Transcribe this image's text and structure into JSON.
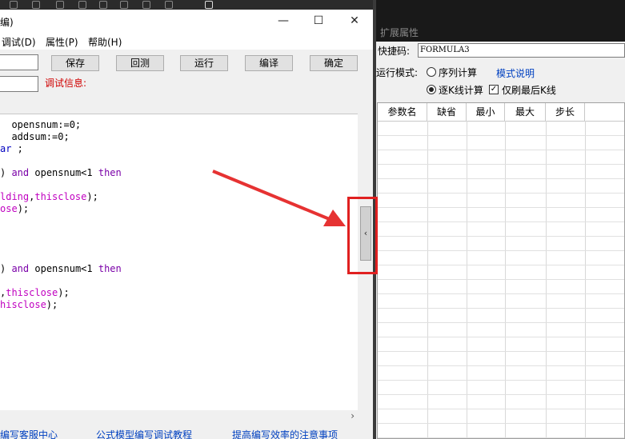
{
  "editor": {
    "title": "编)",
    "menu": [
      {
        "label": "调试(D)"
      },
      {
        "label": "属性(P)"
      },
      {
        "label": "帮助(H)"
      }
    ],
    "toolbar": {
      "save": "保存",
      "back": "回测",
      "run": "运行",
      "compile": "编译",
      "ok": "确定"
    },
    "debug_label": "调试信息:",
    "code_lines": [
      {
        "parts": [
          {
            "t": "  opensnum:=0;",
            "c": ""
          }
        ]
      },
      {
        "parts": [
          {
            "t": "  addsum:=0;",
            "c": ""
          }
        ]
      },
      {
        "parts": [
          {
            "t": "ar",
            "c": "bl"
          },
          {
            "t": " ;",
            "c": ""
          }
        ]
      },
      {
        "parts": [
          {
            "t": ") ",
            "c": ""
          },
          {
            "t": "and",
            "c": "kw"
          },
          {
            "t": " opensnum<1 ",
            "c": ""
          },
          {
            "t": "then",
            "c": "kw"
          }
        ]
      },
      {
        "parts": [
          {
            "t": "lding",
            "c": "vb"
          },
          {
            "t": ",",
            "c": ""
          },
          {
            "t": "thisclose",
            "c": "vb"
          },
          {
            "t": ");",
            "c": ""
          }
        ]
      },
      {
        "parts": [
          {
            "t": "ose",
            "c": "vb"
          },
          {
            "t": ");",
            "c": ""
          }
        ]
      },
      {
        "parts": [
          {
            "t": ") ",
            "c": ""
          },
          {
            "t": "and",
            "c": "kw"
          },
          {
            "t": " opensnum<1 ",
            "c": ""
          },
          {
            "t": "then",
            "c": "kw"
          }
        ]
      },
      {
        "parts": [
          {
            "t": ",",
            "c": ""
          },
          {
            "t": "thisclose",
            "c": "vb"
          },
          {
            "t": ");",
            "c": ""
          }
        ]
      },
      {
        "parts": [
          {
            "t": "hisclose",
            "c": "vb"
          },
          {
            "t": ");",
            "c": ""
          }
        ]
      }
    ],
    "bottom_links": [
      "编写客服中心",
      "公式模型编写调试教程",
      "提高编写效率的注意事项"
    ]
  },
  "panel": {
    "title": "扩展属性",
    "formula_label": "快捷码:",
    "formula_value": "FORMULA3",
    "mode_label": "运行模式:",
    "mode_option1": "序列计算",
    "mode_option2": "逐K线计算",
    "mode_link": "模式说明",
    "last_only": "仅刷最后K线",
    "grid_headers": [
      "参数名",
      "缺省",
      "最小",
      "最大",
      "步长"
    ]
  },
  "colors": {
    "highlight": "#e02020",
    "link": "#0040c0",
    "keyword": "#7a00a8"
  }
}
